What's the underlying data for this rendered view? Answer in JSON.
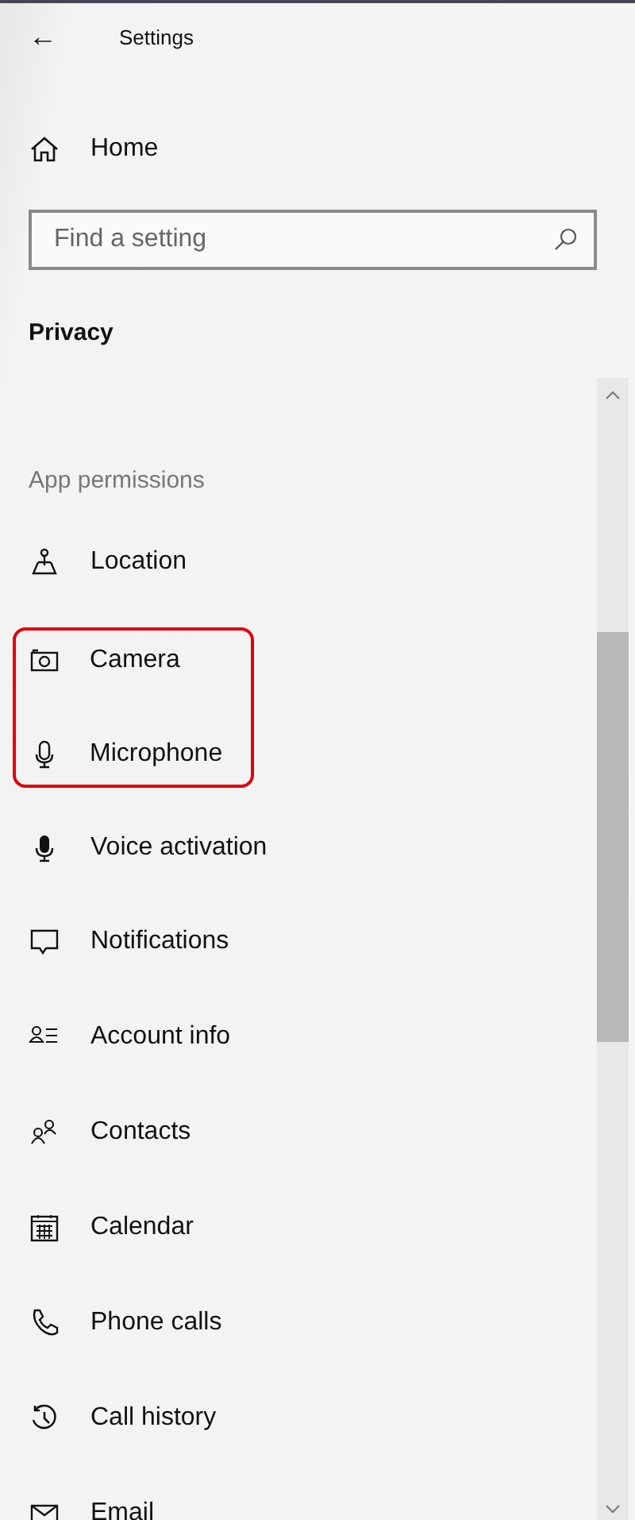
{
  "header": {
    "back": "←",
    "title": "Settings"
  },
  "home": {
    "label": "Home"
  },
  "search": {
    "placeholder": "Find a setting"
  },
  "section_title": "Privacy",
  "group_title": "App permissions",
  "items": [
    {
      "label": "Location",
      "highlighted": false
    },
    {
      "label": "Camera",
      "highlighted": true
    },
    {
      "label": "Microphone",
      "highlighted": true
    },
    {
      "label": "Voice activation",
      "highlighted": false
    },
    {
      "label": "Notifications",
      "highlighted": false
    },
    {
      "label": "Account info",
      "highlighted": false
    },
    {
      "label": "Contacts",
      "highlighted": false
    },
    {
      "label": "Calendar",
      "highlighted": false
    },
    {
      "label": "Phone calls",
      "highlighted": false
    },
    {
      "label": "Call history",
      "highlighted": false
    },
    {
      "label": "Email",
      "highlighted": false
    }
  ]
}
